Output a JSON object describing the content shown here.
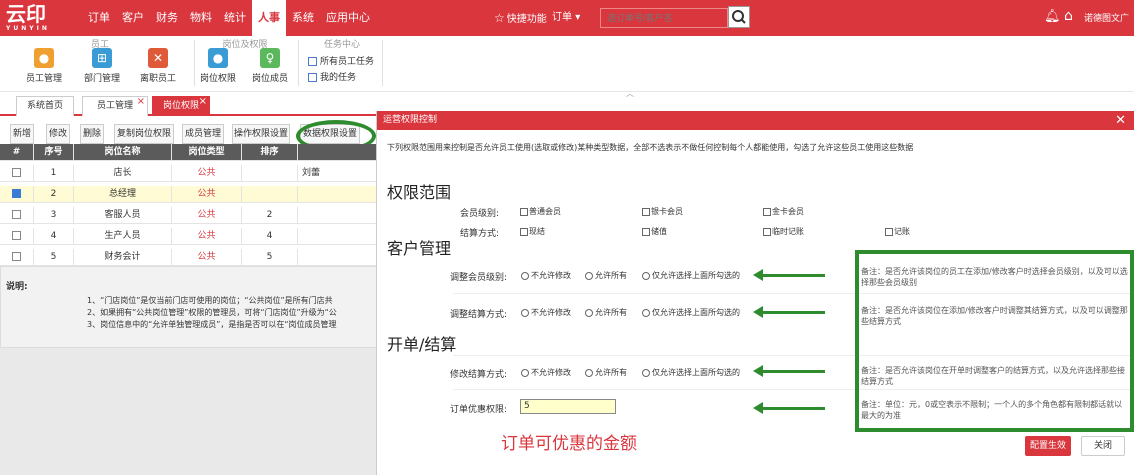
{
  "app": {
    "logo": "云印",
    "logo_sub": "YUNYIN"
  },
  "nav": [
    "订单",
    "客户",
    "财务",
    "物料",
    "统计",
    "人事",
    "系统",
    "应用中心"
  ],
  "header": {
    "quick": "快捷功能",
    "order_select": "订单",
    "search_placeholder": "选订单号/客户名",
    "company": "诺德图文广"
  },
  "ribbon": {
    "groups": [
      "员工",
      "岗位及权限",
      "任务中心"
    ],
    "tools": [
      "员工管理",
      "部门管理",
      "离职员工",
      "岗位权限",
      "岗位成员"
    ],
    "tasks": [
      "所有员工任务",
      "我的任务"
    ]
  },
  "tabs": [
    "系统首页",
    "员工管理",
    "岗位权限"
  ],
  "toolbar": [
    "新增",
    "修改",
    "删除",
    "复制岗位权限",
    "成员管理",
    "操作权限设置",
    "数据权限设置"
  ],
  "grid": {
    "columns": [
      "#",
      "序号",
      "岗位名称",
      "岗位类型",
      "排序",
      ""
    ],
    "rows": [
      {
        "idx": "1",
        "name": "店长",
        "type": "公共",
        "sort": "",
        "extra": "刘蕾",
        "checked": false
      },
      {
        "idx": "2",
        "name": "总经理",
        "type": "公共",
        "sort": "",
        "extra": "",
        "checked": true
      },
      {
        "idx": "3",
        "name": "客服人员",
        "type": "公共",
        "sort": "2",
        "extra": "",
        "checked": false
      },
      {
        "idx": "4",
        "name": "生产人员",
        "type": "公共",
        "sort": "4",
        "extra": "",
        "checked": false
      },
      {
        "idx": "5",
        "name": "财务会计",
        "type": "公共",
        "sort": "5",
        "extra": "",
        "checked": false
      }
    ]
  },
  "notes": {
    "heading": "说明:",
    "lines": [
      "1、“门店岗位”是仅当前门店可使用的岗位；“公共岗位”是所有门店共",
      "2、如果拥有“公共岗位管理”权限的管理员，可将“门店岗位”升级为“公",
      "3、岗位信息中的“允许单独管理成员”，是指是否可以在“岗位成员管理"
    ]
  },
  "dialog": {
    "title": "运营权限控制",
    "desc": "下列权限范围用来控制是否允许员工使用(选取或修改)某种类型数据，全部不选表示不做任何控制每个人都能使用，勾选了允许这些员工使用这些数据",
    "sections": [
      "权限范围",
      "客户管理",
      "开单/结算"
    ],
    "member_level": {
      "label": "会员级别:",
      "options": [
        "普通会员",
        "银卡会员",
        "金卡会员"
      ]
    },
    "settle_method": {
      "label": "结算方式:",
      "options": [
        "现结",
        "储值",
        "临时记账",
        "记账"
      ]
    },
    "radio_options": [
      "不允许修改",
      "允许所有",
      "仅允许选择上面所勾选的"
    ],
    "adjust_member": "调整会员级别:",
    "adjust_settle": "调整结算方式:",
    "modify_settle": "修改结算方式:",
    "discount_label": "订单优惠权限:",
    "discount_value": "5",
    "remarks": [
      "备注：是否允许该岗位的员工在添加/修改客户时选择会员级别，以及可以选择那些会员级别",
      "备注：是否允许该岗位在添加/修改客户时调整其结算方式，以及可以调整那些结算方式",
      "备注：是否允许该岗位在开单时调整客户的结算方式，以及允许选择那些接结算方式",
      "备注：单位：元，0或空表示不限制；一个人的多个角色都有限制都话就以最大的为准"
    ],
    "annotation": "订单可优惠的金额",
    "apply": "配置生效",
    "close": "关闭"
  }
}
